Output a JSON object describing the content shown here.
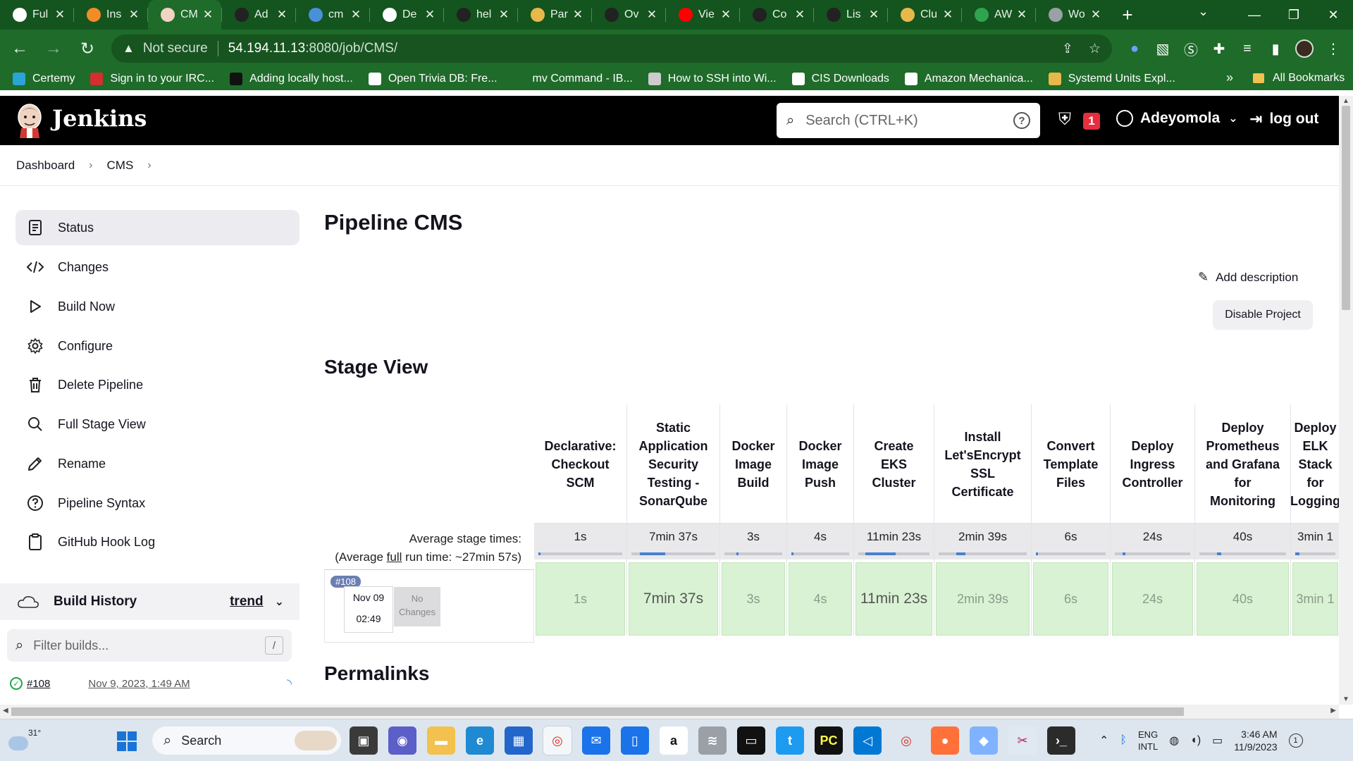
{
  "browser": {
    "tabs": [
      {
        "label": "Ful",
        "icon": "openai-icon",
        "color": "#ffffff"
      },
      {
        "label": "Ins",
        "icon": "orange-app-icon",
        "color": "#f28c28"
      },
      {
        "label": "CM",
        "icon": "jenkins-icon",
        "color": "#f0d3c0",
        "active": true
      },
      {
        "label": "Ad",
        "icon": "github-icon",
        "color": "#222222"
      },
      {
        "label": "cm",
        "icon": "jenkins-spinner-icon",
        "color": "#4a90d9"
      },
      {
        "label": "De",
        "icon": "puzzle-icon",
        "color": "#ffffff"
      },
      {
        "label": "hel",
        "icon": "github-icon",
        "color": "#222222"
      },
      {
        "label": "Par",
        "icon": "colorful-icon",
        "color": "#e8b84a"
      },
      {
        "label": "Ov",
        "icon": "github-icon",
        "color": "#222222"
      },
      {
        "label": "Vie",
        "icon": "youtube-icon",
        "color": "#ff0000"
      },
      {
        "label": "Co",
        "icon": "github-icon",
        "color": "#222222"
      },
      {
        "label": "Lis",
        "icon": "github-icon",
        "color": "#222222"
      },
      {
        "label": "Clu",
        "icon": "colorful-icon",
        "color": "#e8b84a"
      },
      {
        "label": "AW",
        "icon": "w-icon",
        "color": "#2ea44f"
      },
      {
        "label": "Wo",
        "icon": "globe-icon",
        "color": "#9aa0a6"
      }
    ],
    "address": {
      "security_label": "Not secure",
      "host": "54.194.11.13",
      "path": ":8080/job/CMS/"
    },
    "bookmarks": [
      {
        "label": "Certemy",
        "icon": "c-icon",
        "color": "#2aa4d6"
      },
      {
        "label": "Sign in to your IRC...",
        "icon": "maple-leaf-icon",
        "color": "#d32f2f"
      },
      {
        "label": "Adding locally host...",
        "icon": "github-icon",
        "color": "#111111"
      },
      {
        "label": "Open Trivia DB: Fre...",
        "icon": "globe-icon",
        "color": "#ffffff"
      },
      {
        "label": "mv Command - IB...",
        "icon": "ibm-icon",
        "color": "#1f6b2a"
      },
      {
        "label": "How to SSH into Wi...",
        "icon": "image-icon",
        "color": "#cccccc"
      },
      {
        "label": "CIS Downloads",
        "icon": "cis-icon",
        "color": "#ffffff"
      },
      {
        "label": "Amazon Mechanica...",
        "icon": "amazon-icon",
        "color": "#ffffff"
      },
      {
        "label": "Systemd Units Expl...",
        "icon": "circle-icon",
        "color": "#e8b84a"
      }
    ],
    "all_bookmarks_label": "All Bookmarks"
  },
  "jenkins": {
    "title": "Jenkins",
    "search_placeholder": "Search (CTRL+K)",
    "alert_count": "1",
    "user": "Adeyomola",
    "logout": "log out"
  },
  "breadcrumb": [
    "Dashboard",
    "CMS"
  ],
  "sidebar": {
    "items": [
      {
        "label": "Status",
        "icon": "notepad-icon",
        "active": true
      },
      {
        "label": "Changes",
        "icon": "code-icon"
      },
      {
        "label": "Build Now",
        "icon": "play-icon"
      },
      {
        "label": "Configure",
        "icon": "gear-icon"
      },
      {
        "label": "Delete Pipeline",
        "icon": "trash-icon"
      },
      {
        "label": "Full Stage View",
        "icon": "search-icon"
      },
      {
        "label": "Rename",
        "icon": "pencil-icon"
      },
      {
        "label": "Pipeline Syntax",
        "icon": "help-circle-icon"
      },
      {
        "label": "GitHub Hook Log",
        "icon": "clipboard-icon"
      }
    ],
    "build_history": {
      "title": "Build History",
      "trend": "trend",
      "filter_placeholder": "Filter builds...",
      "filter_shortcut": "/",
      "builds": [
        {
          "number": "#108",
          "date": "Nov 9, 2023, 1:49 AM"
        }
      ]
    }
  },
  "main": {
    "title": "Pipeline CMS",
    "add_description": "Add description",
    "disable_project": "Disable Project",
    "stage_view_title": "Stage View",
    "avg_stage_label": "Average stage times:",
    "avg_run_prefix": "(Average ",
    "avg_run_full": "full",
    "avg_run_suffix": " run time: ~27min 57s)",
    "build": {
      "badge": "#108",
      "date": "Nov 09",
      "time": "02:49",
      "changes": "No Changes"
    },
    "stages": [
      {
        "name": "Declarative: Checkout SCM",
        "avg": "1s",
        "run": "1s",
        "bar": 0.02
      },
      {
        "name": "Static Application Security Testing - SonarQube",
        "avg": "7min 37s",
        "run": "7min 37s",
        "bar": 0.3
      },
      {
        "name": "Docker Image Build",
        "avg": "3s",
        "run": "3s",
        "bar": 0.03
      },
      {
        "name": "Docker Image Push",
        "avg": "4s",
        "run": "4s",
        "bar": 0.03
      },
      {
        "name": "Create EKS Cluster",
        "avg": "11min 23s",
        "run": "11min 23s",
        "bar": 0.42
      },
      {
        "name": "Install Let'sEncrypt SSL Certificate",
        "avg": "2min 39s",
        "run": "2min 39s",
        "bar": 0.1
      },
      {
        "name": "Convert Template Files",
        "avg": "6s",
        "run": "6s",
        "bar": 0.03
      },
      {
        "name": "Deploy Ingress Controller",
        "avg": "24s",
        "run": "24s",
        "bar": 0.04
      },
      {
        "name": "Deploy Prometheus and Grafana for Monitoring",
        "avg": "40s",
        "run": "40s",
        "bar": 0.05
      },
      {
        "name": "Deploy ELK Stack for Logging",
        "avg": "3min 1",
        "run": "3min 1",
        "bar": 0.1
      }
    ],
    "permalinks_title": "Permalinks"
  },
  "taskbar": {
    "temperature": "31°",
    "search_label": "Search",
    "language": "ENG",
    "layout": "INTL",
    "time": "3:46 AM",
    "date": "11/9/2023",
    "notifications": "1"
  }
}
